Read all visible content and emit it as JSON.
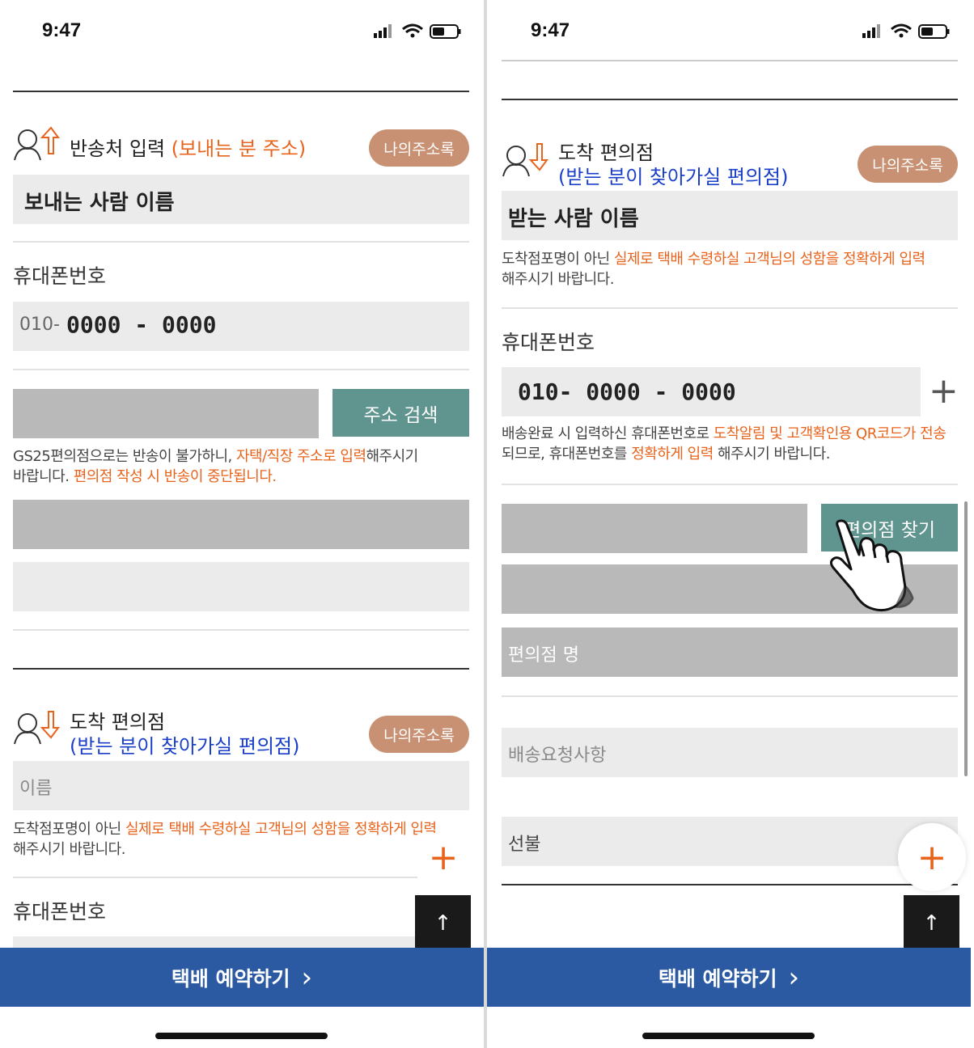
{
  "status": {
    "time": "9:47"
  },
  "left": {
    "sender_section": {
      "title": "반송처 입력",
      "title_sub": "(보내는 분 주소)",
      "address_book": "나의주소록",
      "name_placeholder": "보내는 사람 이름",
      "phone_label": "휴대폰번호",
      "phone_prefix": "010-",
      "phone_value": "0000 - 0000",
      "address_search": "주소 검색",
      "note_1": "GS25편의점으로는 반송이 불가하니, ",
      "note_2": "자택/직장 주소로 입력",
      "note_3": "해주시기",
      "note_4": "바랍니다. ",
      "note_5": "편의점 작성 시 반송이 중단됩니다."
    },
    "arrival_section": {
      "title": "도착 편의점",
      "title_sub": "(받는 분이 찾아가실 편의점)",
      "address_book": "나의주소록",
      "name_placeholder": "이름",
      "note_1": "도착점포명이 아닌 ",
      "note_2": "실제로 택배 수령하실 고객님의 성함을 정확하게 입력",
      "note_3": "해주시기 바랍니다.",
      "phone_label": "휴대폰번호"
    },
    "reserve_button": "택배 예약하기",
    "reserve_chevron": "›"
  },
  "right": {
    "arrival_section": {
      "title": "도착 편의점",
      "title_sub": "(받는 분이 찾아가실 편의점)",
      "address_book": "나의주소록",
      "name_placeholder": "받는 사람 이름",
      "note_1": "도착점포명이 아닌 ",
      "note_2": "실제로 택배 수령하실 고객님의 성함을 정확하게 입력",
      "note_3": "해주시기 바랍니다.",
      "phone_label": "휴대폰번호",
      "phone_value": "010- 0000 - 0000",
      "phone_note_1": "배송완료 시 입력하신 휴대폰번호로 ",
      "phone_note_2": "도착알림 및 고객확인용 QR코드가 전송",
      "phone_note_3": "되므로, 휴대폰번호를 ",
      "phone_note_4": "정확하게 입력",
      "phone_note_5": " 해주시기 바랍니다.",
      "store_find": "편의점 찾기",
      "store_name_placeholder": "편의점 명",
      "delivery_request_placeholder": "배송요청사항",
      "payment_value": "선불"
    },
    "reserve_button": "택배 예약하기",
    "reserve_chevron": "›"
  },
  "icons": {
    "top_arrow": "↑",
    "plus": "+"
  },
  "colors": {
    "accent_orange": "#e8631c",
    "blue_text": "#1a3fc8",
    "pill_brown": "#c99173",
    "teal": "#5f958e",
    "bottom_bar": "#2b5aa3"
  }
}
